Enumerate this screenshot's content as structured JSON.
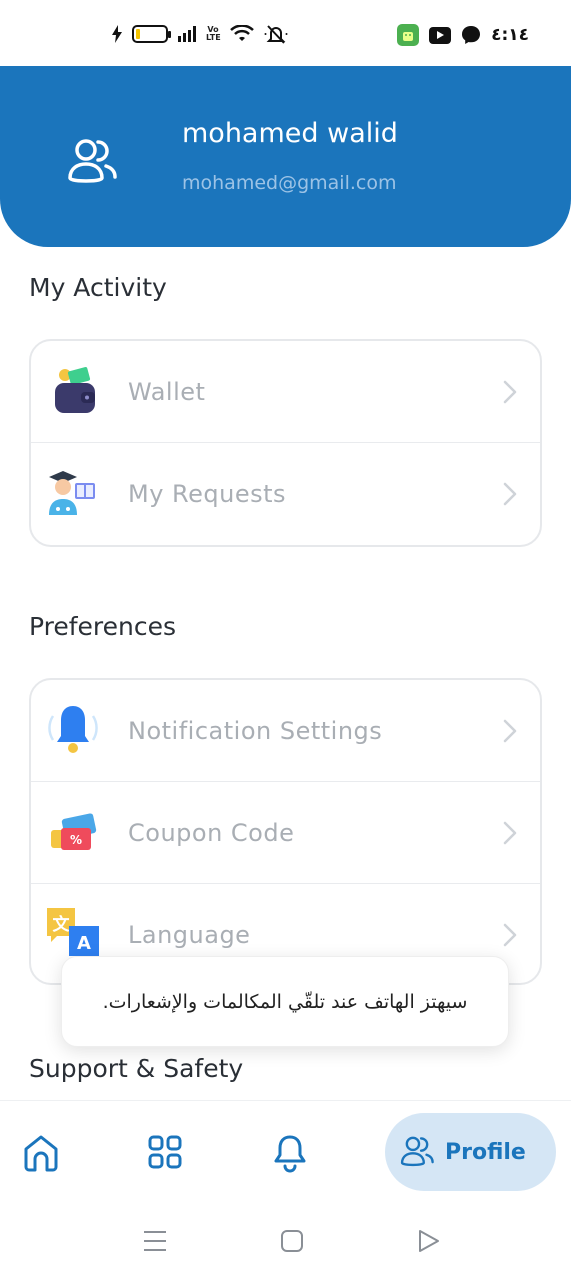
{
  "status_bar": {
    "time": "٤:١٤",
    "network_label": "Vo LTE",
    "icons": [
      "charging-icon",
      "battery-icon",
      "signal-icon",
      "volte-icon",
      "wifi-icon",
      "mute-icon",
      "android-app-icon",
      "youtube-icon",
      "messenger-icon"
    ]
  },
  "header": {
    "name": "mohamed walid",
    "email": "mohamed@gmail.com",
    "color": "#1b75bc"
  },
  "sections": {
    "activity": {
      "title": "My Activity",
      "items": [
        {
          "label": "Wallet",
          "icon": "wallet-icon"
        },
        {
          "label": "My Requests",
          "icon": "student-requests-icon"
        }
      ]
    },
    "preferences": {
      "title": "Preferences",
      "items": [
        {
          "label": "Notification Settings",
          "icon": "bell-icon"
        },
        {
          "label": "Coupon Code",
          "icon": "coupon-icon"
        },
        {
          "label": "Language",
          "icon": "translate-icon"
        }
      ]
    },
    "support": {
      "title": "Support & Safety"
    }
  },
  "toast": {
    "message": "سيهتز الهاتف عند تلقّي المكالمات والإشعارات."
  },
  "bottom_nav": {
    "items": [
      "home-icon",
      "grid-icon",
      "bell-icon",
      "profile-icon"
    ],
    "active_label": "Profile",
    "accent": "#1b75bc"
  }
}
